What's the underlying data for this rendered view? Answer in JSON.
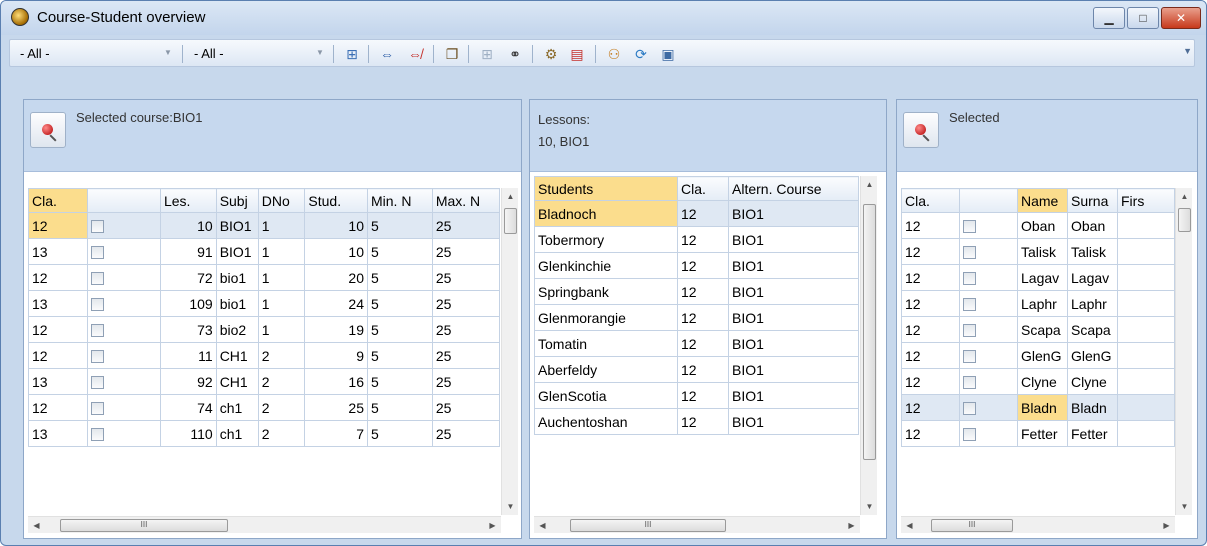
{
  "window": {
    "title": "Course-Student overview",
    "minimize": "▁",
    "maximize": "□",
    "close": "✕"
  },
  "toolbar": {
    "filter1": "- All -",
    "filter2": "- All -"
  },
  "courses": {
    "header_label": "Selected course:BIO1",
    "columns": [
      "Cla.",
      "",
      "Les.",
      "Subj",
      "DNo",
      "Stud.",
      "Min. N",
      "Max. N"
    ],
    "rows": [
      [
        "12",
        "10",
        "BIO1",
        "1",
        "10",
        "5",
        "25"
      ],
      [
        "13",
        "91",
        "BIO1",
        "1",
        "10",
        "5",
        "25"
      ],
      [
        "12",
        "72",
        "bio1",
        "1",
        "20",
        "5",
        "25"
      ],
      [
        "13",
        "109",
        "bio1",
        "1",
        "24",
        "5",
        "25"
      ],
      [
        "12",
        "73",
        "bio2",
        "1",
        "19",
        "5",
        "25"
      ],
      [
        "12",
        "11",
        "CH1",
        "2",
        "9",
        "5",
        "25"
      ],
      [
        "13",
        "92",
        "CH1",
        "2",
        "16",
        "5",
        "25"
      ],
      [
        "12",
        "74",
        "ch1",
        "2",
        "25",
        "5",
        "25"
      ],
      [
        "13",
        "110",
        "ch1",
        "2",
        "7",
        "5",
        "25"
      ]
    ]
  },
  "lessons": {
    "header_line1": "Lessons:",
    "header_line2": "10, BIO1",
    "columns": [
      "Students",
      "Cla.",
      "Altern. Course"
    ],
    "rows": [
      [
        "Bladnoch",
        "12",
        "BIO1"
      ],
      [
        "Tobermory",
        "12",
        "BIO1"
      ],
      [
        "Glenkinchie",
        "12",
        "BIO1"
      ],
      [
        "Springbank",
        "12",
        "BIO1"
      ],
      [
        "Glenmorangie",
        "12",
        "BIO1"
      ],
      [
        "Tomatin",
        "12",
        "BIO1"
      ],
      [
        "Aberfeldy",
        "12",
        "BIO1"
      ],
      [
        "GlenScotia",
        "12",
        "BIO1"
      ],
      [
        "Auchentoshan",
        "12",
        "BIO1"
      ]
    ]
  },
  "selected": {
    "header_label": "Selected",
    "columns": [
      "Cla.",
      "",
      "Name",
      "Surna",
      "Firs"
    ],
    "rows": [
      [
        "12",
        "Oban",
        "Oban"
      ],
      [
        "12",
        "Talisk",
        "Talisk"
      ],
      [
        "12",
        "Lagav",
        "Lagav"
      ],
      [
        "12",
        "Laphr",
        "Laphr"
      ],
      [
        "12",
        "Scapa",
        "Scapa"
      ],
      [
        "12",
        "GlenG",
        "GlenG"
      ],
      [
        "12",
        "Clyne",
        "Clyne"
      ],
      [
        "12",
        "Bladn",
        "Bladn"
      ],
      [
        "12",
        "Fetter",
        "Fetter"
      ]
    ]
  },
  "scroll_glyph": "III"
}
